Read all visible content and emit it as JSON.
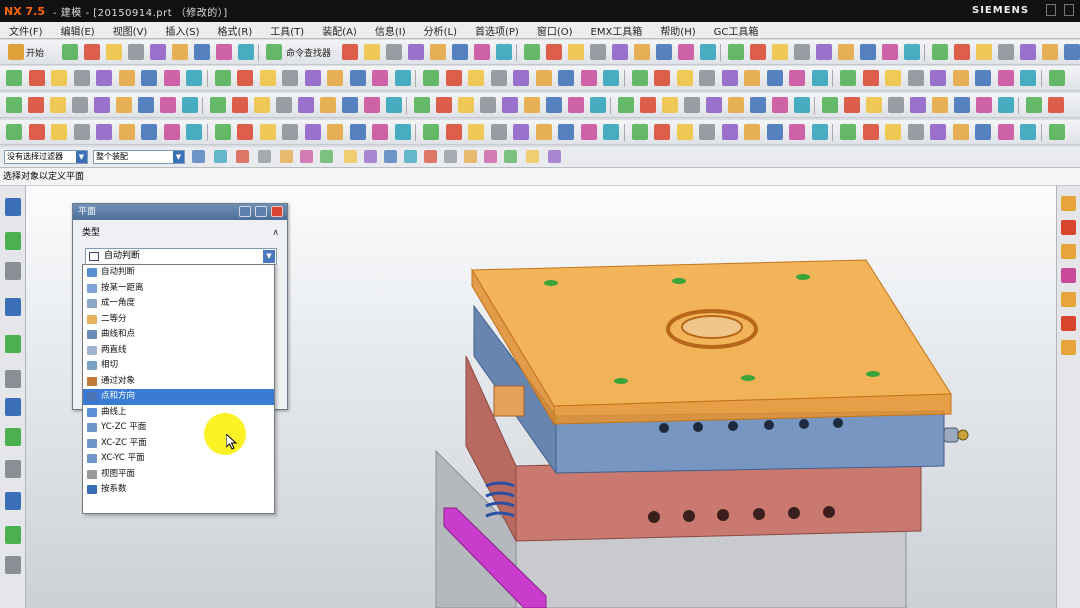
{
  "titlebar": {
    "app": "NX 7.5",
    "title": "- 建模 - [20150914.prt （修改的）]",
    "brand": "SIEMENS"
  },
  "menubar": {
    "items": [
      "文件(F)",
      "编辑(E)",
      "视图(V)",
      "插入(S)",
      "格式(R)",
      "工具(T)",
      "装配(A)",
      "信息(I)",
      "分析(L)",
      "首选项(P)",
      "窗口(O)",
      "EMX工具箱",
      "帮助(H)",
      "GC工具箱"
    ]
  },
  "toolbar": {
    "start_label": "开始",
    "command_finder_label": "命令查找器"
  },
  "selection": {
    "filter_value": "没有选择过滤器",
    "scope_value": "整个装配"
  },
  "cue": "选择对象以定义平面",
  "dialog": {
    "title": "平面",
    "section_label": "类型",
    "selected_type": "自动判断",
    "options": [
      "自动判断",
      "按某一距离",
      "成一角度",
      "二等分",
      "曲线和点",
      "两直线",
      "相切",
      "通过对象",
      "点和方向",
      "曲线上",
      "YC-ZC 平面",
      "XC-ZC 平面",
      "XC-YC 平面",
      "视图平面",
      "按系数"
    ],
    "highlighted_option": "点和方向"
  },
  "colors": {
    "plate_top": "#f5a93e",
    "plate_blue": "#7796c1",
    "plate_red": "#c9796f",
    "plate_gray": "#c8cacd",
    "plate_magenta": "#c93ccc",
    "selection_blue": "#3a7bd5",
    "cursor_highlight": "#f7ef00"
  }
}
